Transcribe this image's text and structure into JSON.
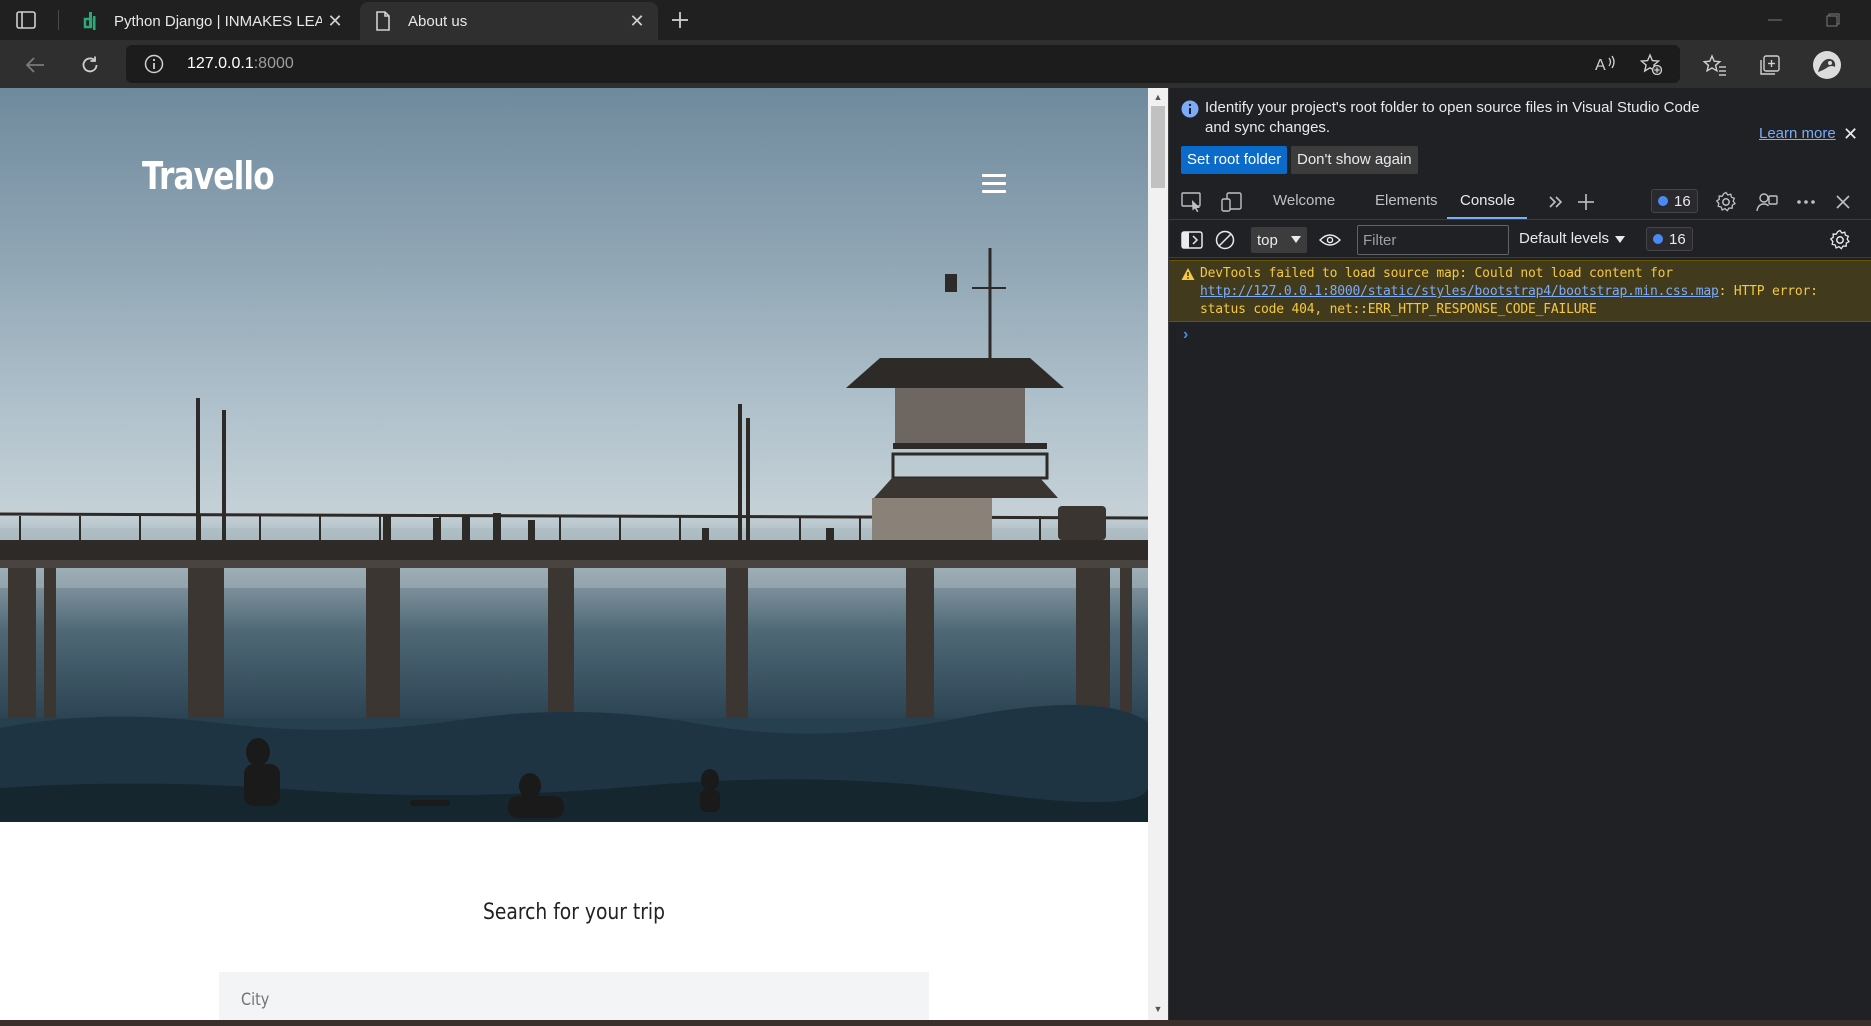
{
  "browser": {
    "tabs": [
      {
        "title": "Python Django | INMAKES LEARNING HUB",
        "active": false
      },
      {
        "title": "About us",
        "active": true
      }
    ],
    "address": {
      "host": "127.0.0.1",
      "port": ":8000"
    }
  },
  "page": {
    "brand": "Travello",
    "search_title": "Search for your trip",
    "city_label": "City"
  },
  "devtools": {
    "notice": {
      "text": "Identify your project's root folder to open source files in Visual Studio Code and sync changes.",
      "learn_more": "Learn more",
      "set_root": "Set root folder",
      "dont_show": "Don't show again"
    },
    "tabs": [
      "Welcome",
      "Elements",
      "Console"
    ],
    "active_tab": "Console",
    "issues_count": "16",
    "console": {
      "context": "top",
      "filter_placeholder": "Filter",
      "levels": "Default levels",
      "messages_count": "16",
      "warning": {
        "prefix": "DevTools failed to load source map: Could not load content for ",
        "link": "http://127.0.0.1:8000/static/styles/bootstrap4/bootstrap.min.css.map",
        "suffix": ": HTTP error: status code 404, net::ERR_HTTP_RESPONSE_CODE_FAILURE"
      },
      "prompt": "›"
    }
  },
  "colors": {
    "accent_blue": "#0b6bcb",
    "warning_text": "#f5c842",
    "link": "#7cacf8"
  }
}
